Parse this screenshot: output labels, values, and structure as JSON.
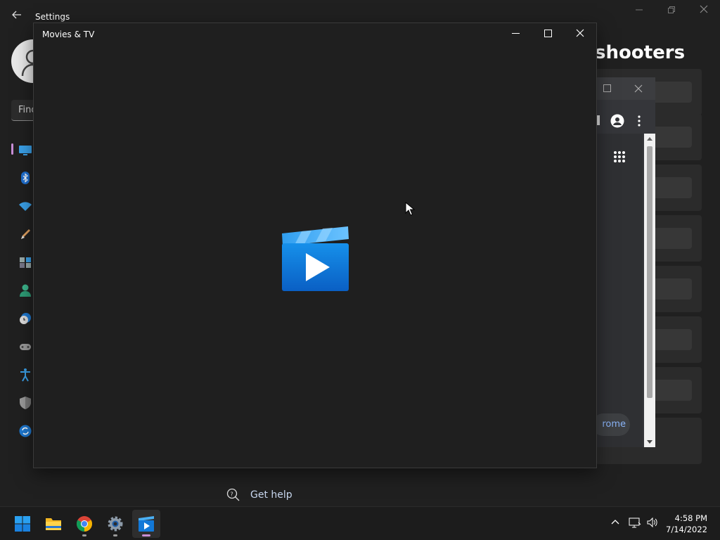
{
  "settings": {
    "title": "Settings",
    "search_placeholder": "Find a setting",
    "search_visible": "Find",
    "page_heading_visible": "shooters",
    "get_help": "Get help"
  },
  "chrome": {
    "pill_text": "rome"
  },
  "movies": {
    "title": "Movies & TV"
  },
  "taskbar": {
    "time": "4:58 PM",
    "date": "7/14/2022"
  },
  "colors": {
    "accent_pink": "#c88ed6",
    "app_blue": "#0a74d6",
    "chrome_link": "#8ab4f8"
  }
}
